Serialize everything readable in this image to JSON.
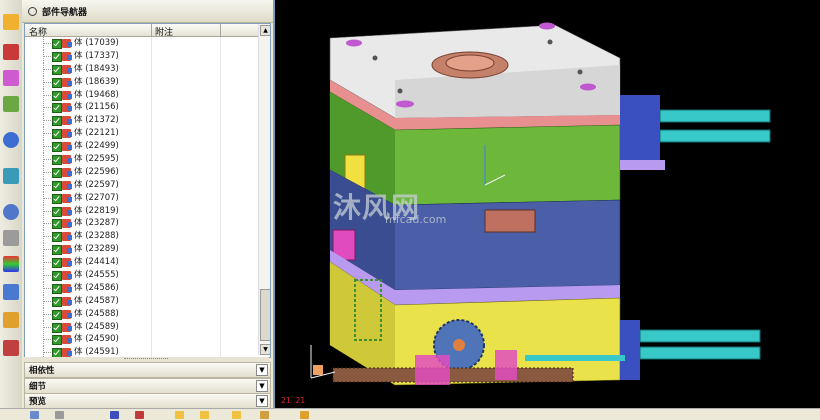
{
  "navigator": {
    "title": "部件导航器",
    "columns": [
      "名称",
      "附注"
    ],
    "items": [
      {
        "label": "体 (17039)"
      },
      {
        "label": "体 (17337)"
      },
      {
        "label": "体 (18493)"
      },
      {
        "label": "体 (18639)"
      },
      {
        "label": "体 (19468)"
      },
      {
        "label": "体 (21156)"
      },
      {
        "label": "体 (21372)"
      },
      {
        "label": "体 (22121)"
      },
      {
        "label": "体 (22499)"
      },
      {
        "label": "体 (22595)"
      },
      {
        "label": "体 (22596)"
      },
      {
        "label": "体 (22597)"
      },
      {
        "label": "体 (22707)"
      },
      {
        "label": "体 (22819)"
      },
      {
        "label": "体 (23287)"
      },
      {
        "label": "体 (23288)"
      },
      {
        "label": "体 (23289)"
      },
      {
        "label": "体 (24414)"
      },
      {
        "label": "体 (24555)"
      },
      {
        "label": "体 (24586)"
      },
      {
        "label": "体 (24587)"
      },
      {
        "label": "体 (24588)"
      },
      {
        "label": "体 (24589)"
      },
      {
        "label": "体 (24590)"
      },
      {
        "label": "体 (24591)"
      }
    ],
    "sections": [
      {
        "label": "相依性"
      },
      {
        "label": "细节"
      },
      {
        "label": "预览"
      }
    ]
  },
  "viewport": {
    "coord_readout": "21   21",
    "watermark": "沐风网",
    "watermark_url": "mfcad.com"
  },
  "colors": {
    "panel_bg": "#ece9d8",
    "viewport_bg": "#000000",
    "plate_top": "#e8e8e8",
    "plate_green": "#6fb83a",
    "plate_blue": "#4a5fa8",
    "plate_yellow": "#e8e04a",
    "cylinder_cyan": "#38c8c8"
  }
}
